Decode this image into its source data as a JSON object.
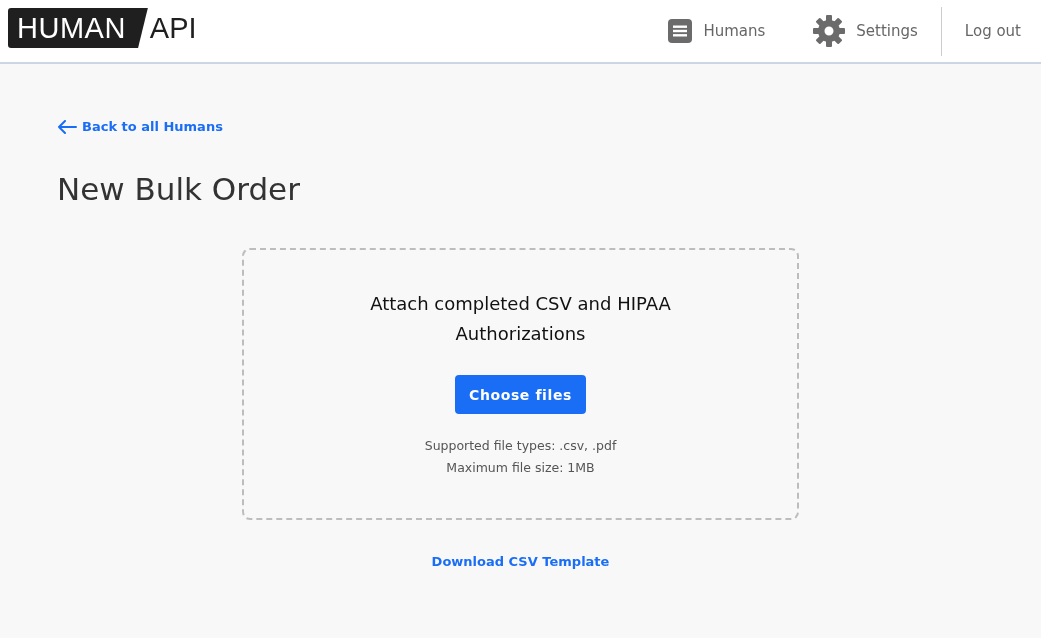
{
  "header": {
    "logo": {
      "mark": "HUMAN",
      "text": "API"
    },
    "nav": [
      {
        "kind": "list",
        "label": "Humans"
      },
      {
        "kind": "gear",
        "label": "Settings"
      }
    ],
    "logout": "Log out"
  },
  "back_link": "Back to all Humans",
  "title": "New Bulk Order",
  "upload": {
    "heading": "Attach completed CSV and HIPAA Authorizations",
    "button": "Choose files",
    "notes": [
      "Supported file types: .csv, .pdf",
      "Maximum file size: 1MB"
    ]
  },
  "template_link": "Download CSV Template"
}
